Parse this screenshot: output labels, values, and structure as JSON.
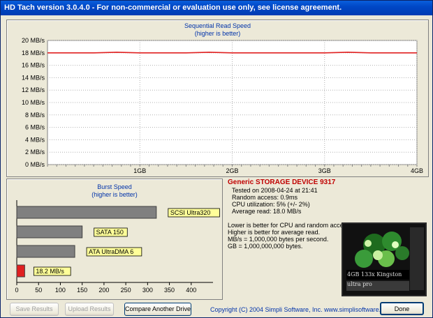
{
  "window": {
    "title": "HD Tach version 3.0.4.0  - For non-commercial or evaluation use only, see license agreement."
  },
  "read_chart": {
    "title": "Sequential Read Speed",
    "subtitle": "(higher is better)",
    "y_ticks": [
      "20 MB/s",
      "18 MB/s",
      "16 MB/s",
      "14 MB/s",
      "12 MB/s",
      "10 MB/s",
      "8 MB/s",
      "6 MB/s",
      "4 MB/s",
      "2 MB/s",
      "0 MB/s"
    ],
    "x_ticks": [
      "1GB",
      "2GB",
      "3GB",
      "4GB"
    ],
    "line_color": "#e02020"
  },
  "burst_chart": {
    "title": "Burst Speed",
    "subtitle": "(higher is better)",
    "x_ticks": [
      "0",
      "50",
      "100",
      "150",
      "200",
      "250",
      "300",
      "350",
      "400"
    ],
    "bars": [
      {
        "label": "SCSI Ultra320",
        "value": 320,
        "color": "#808080"
      },
      {
        "label": "SATA 150",
        "value": 150,
        "color": "#808080"
      },
      {
        "label": "ATA UltraDMA 6",
        "value": 133,
        "color": "#808080"
      },
      {
        "label": "18.2 MB/s",
        "value": 18.2,
        "color": "#e02020"
      }
    ]
  },
  "chart_data": [
    {
      "type": "line",
      "title": "Sequential Read Speed",
      "subtitle": "(higher is better)",
      "xlabel": "",
      "ylabel": "",
      "x": [
        0,
        0.25,
        0.5,
        0.75,
        1,
        1.25,
        1.5,
        1.75,
        2,
        2.25,
        2.5,
        2.75,
        3,
        3.25,
        3.5,
        3.75,
        4
      ],
      "series": [
        {
          "values": [
            18.0,
            18.0,
            18.0,
            18.1,
            18.0,
            18.0,
            18.0,
            18.1,
            18.0,
            18.0,
            18.0,
            18.0,
            18.0,
            18.1,
            18.0,
            18.0,
            18.0
          ]
        }
      ],
      "xlim": [
        0,
        4
      ],
      "ylim": [
        0,
        20
      ],
      "x_tick_labels": [
        "1GB",
        "2GB",
        "3GB",
        "4GB"
      ],
      "y_tick_labels": [
        "0 MB/s",
        "2 MB/s",
        "4 MB/s",
        "6 MB/s",
        "8 MB/s",
        "10 MB/s",
        "12 MB/s",
        "14 MB/s",
        "16 MB/s",
        "18 MB/s",
        "20 MB/s"
      ],
      "grid": true
    },
    {
      "type": "bar",
      "title": "Burst Speed",
      "subtitle": "(higher is better)",
      "categories": [
        "SCSI Ultra320",
        "SATA 150",
        "ATA UltraDMA 6",
        "18.2 MB/s"
      ],
      "values": [
        320,
        150,
        133,
        18.2
      ],
      "xlim": [
        0,
        450
      ],
      "x_tick_labels": [
        "0",
        "50",
        "100",
        "150",
        "200",
        "250",
        "300",
        "350",
        "400"
      ],
      "orientation": "horizontal",
      "grid": false
    }
  ],
  "info": {
    "device": "Generic STORAGE DEVICE 9317",
    "tested": "Tested on 2008-04-24 at 21:41",
    "random_access": "Random access: 0.9ms",
    "cpu": "CPU utilization: 5% (+/- 2%)",
    "avg_read": "Average read: 18.0 MB/s",
    "note1": "Lower is better for CPU and random access.",
    "note2": "Higher is better for average read.",
    "note3": "MB/s = 1,000,000 bytes per second.",
    "note4": "GB = 1,000,000,000 bytes."
  },
  "photo": {
    "caption_text": "4GB  133x  Kingston  ultra pro"
  },
  "buttons": {
    "save": "Save Results",
    "upload": "Upload Results",
    "compare": "Compare Another Drive",
    "done": "Done"
  },
  "footer": {
    "copyright": "Copyright (C) 2004 Simpli Software, Inc. www.simplisoftware.com"
  }
}
